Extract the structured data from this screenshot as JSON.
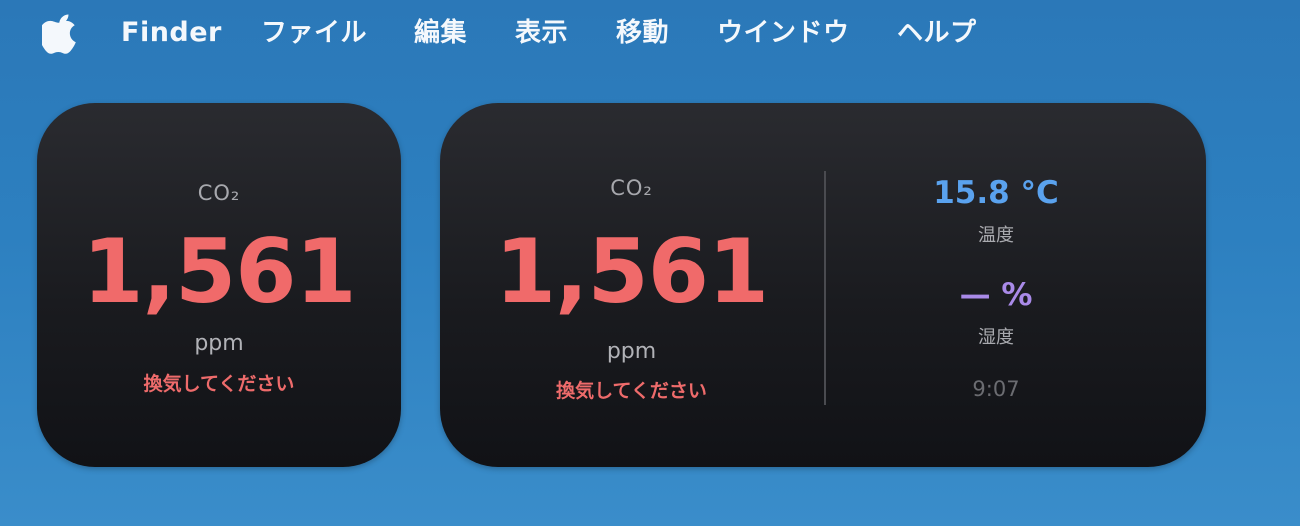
{
  "menubar": {
    "apple_icon": "apple-logo-icon",
    "app_name": "Finder",
    "items": [
      "ファイル",
      "編集",
      "表示",
      "移動",
      "ウインドウ",
      "ヘルプ"
    ]
  },
  "widget_small": {
    "co2_label": "CO₂",
    "co2_value": "1,561",
    "co2_unit": "ppm",
    "co2_alert": "換気してください"
  },
  "widget_medium": {
    "co2_label": "CO₂",
    "co2_value": "1,561",
    "co2_unit": "ppm",
    "co2_alert": "換気してください",
    "temperature_value": "15.8 °C",
    "temperature_label": "温度",
    "humidity_value": "— %",
    "humidity_label": "湿度",
    "time": "9:07"
  },
  "colors": {
    "co2_alert": "#f06a6a",
    "temperature": "#5aa2ee",
    "humidity": "#a98ae8",
    "widget_background": "#1a1b1f",
    "desktop_background": "#2d80c0"
  }
}
